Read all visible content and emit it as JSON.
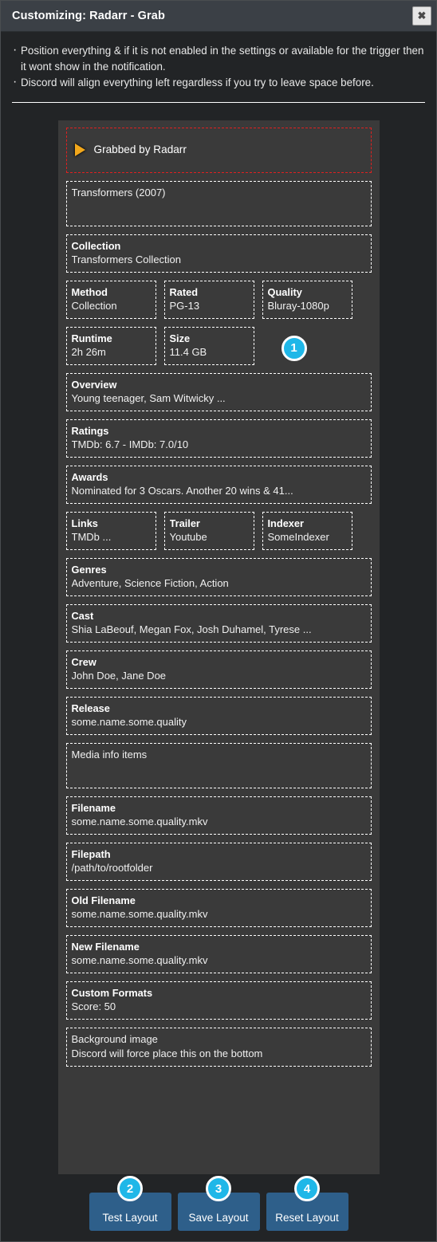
{
  "titlebar": {
    "title": "Customizing: Radarr - Grab",
    "close_icon": "close-icon",
    "close_glyph": "✖"
  },
  "notes": [
    "Position everything & if it is not enabled in the settings or available for the trigger then it wont show in the notification.",
    "Discord will align everything left regardless if you try to leave space before."
  ],
  "layout": {
    "header_item": {
      "icon": "play-triangle-icon",
      "label": "Grabbed by Radarr",
      "border_color": "#e02020"
    },
    "title_item": {
      "value": "Transformers (2007)"
    },
    "collection": {
      "label": "Collection",
      "value": "Transformers Collection"
    },
    "row_one": [
      {
        "label": "Method",
        "value": "Collection"
      },
      {
        "label": "Rated",
        "value": "PG-13"
      },
      {
        "label": "Quality",
        "value": "Bluray-1080p"
      }
    ],
    "row_two": [
      {
        "label": "Runtime",
        "value": "2h 26m"
      },
      {
        "label": "Size",
        "value": "11.4 GB"
      }
    ],
    "row_two_badge": "1",
    "overview": {
      "label": "Overview",
      "value": "Young teenager, Sam Witwicky ..."
    },
    "ratings": {
      "label": "Ratings",
      "value": "TMDb: 6.7 - IMDb: 7.0/10"
    },
    "awards": {
      "label": "Awards",
      "value": "Nominated for 3 Oscars. Another 20 wins & 41..."
    },
    "row_three": [
      {
        "label": "Links",
        "value": "TMDb ..."
      },
      {
        "label": "Trailer",
        "value": "Youtube"
      },
      {
        "label": "Indexer",
        "value": "SomeIndexer"
      }
    ],
    "genres": {
      "label": "Genres",
      "value": "Adventure, Science Fiction, Action"
    },
    "cast": {
      "label": "Cast",
      "value": "Shia LaBeouf, Megan Fox, Josh Duhamel, Tyrese ..."
    },
    "crew": {
      "label": "Crew",
      "value": "John Doe, Jane Doe"
    },
    "release": {
      "label": "Release",
      "value": "some.name.some.quality"
    },
    "media_info": {
      "value": "Media info items"
    },
    "filename": {
      "label": "Filename",
      "value": "some.name.some.quality.mkv"
    },
    "filepath": {
      "label": "Filepath",
      "value": "/path/to/rootfolder"
    },
    "old_filename": {
      "label": "Old Filename",
      "value": "some.name.some.quality.mkv"
    },
    "new_filename": {
      "label": "New Filename",
      "value": "some.name.some.quality.mkv"
    },
    "custom_formats": {
      "label": "Custom Formats",
      "value": "Score: 50"
    },
    "background_image": {
      "line1": "Background image",
      "line2": "Discord will force place this on the bottom"
    }
  },
  "footer": {
    "buttons": [
      {
        "label": "Test Layout",
        "badge": "2"
      },
      {
        "label": "Save Layout",
        "badge": "3"
      },
      {
        "label": "Reset Layout",
        "badge": "4"
      }
    ]
  },
  "colors": {
    "accent_badge": "#1fb7e8",
    "button": "#2e5f8a",
    "highlight_border": "#e02020",
    "play_icon": "#f2a71b",
    "titlebar": "#3b4046",
    "canvas": "#3a3a3a",
    "modal_bg": "#222426"
  }
}
